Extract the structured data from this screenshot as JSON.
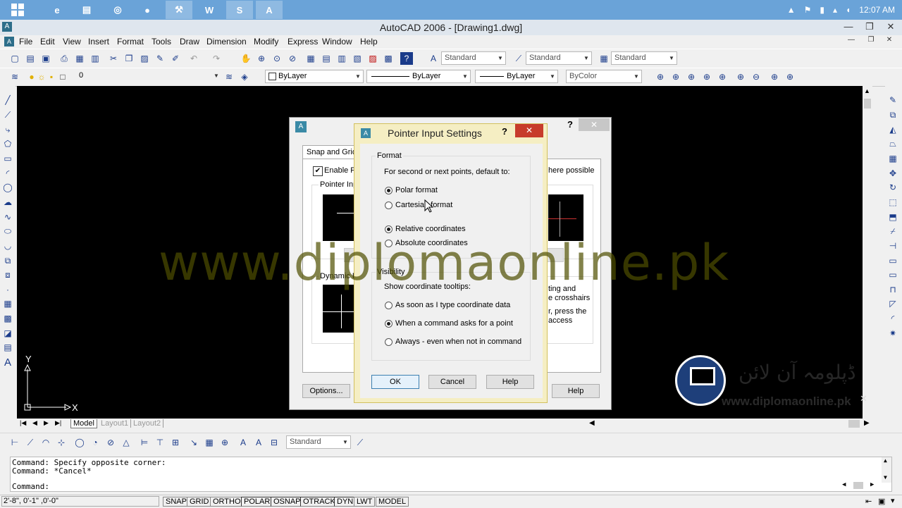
{
  "taskbar": {
    "apps": [
      "start-icon",
      "ie-icon",
      "explorer-icon",
      "chrome-icon",
      "firefox-icon",
      "tool-icon",
      "word-icon",
      "skype-icon",
      "autocad-icon"
    ],
    "clock": "12:07 AM"
  },
  "window": {
    "title": "AutoCAD 2006 - [Drawing1.dwg]"
  },
  "menu": [
    "File",
    "Edit",
    "View",
    "Insert",
    "Format",
    "Tools",
    "Draw",
    "Dimension",
    "Modify",
    "Express",
    "Window",
    "Help"
  ],
  "styles": {
    "text_style": "Standard",
    "dim_style": "Standard",
    "table_style": "Standard",
    "multileader_style": "Standard"
  },
  "layers": {
    "current": "0"
  },
  "properties": {
    "color": "ByLayer",
    "linetype": "ByLayer",
    "lineweight": "ByLayer",
    "plotstyle": "ByColor"
  },
  "watermark": "www.diplomaonline.pk",
  "back_dialog": {
    "tab": "Snap and Grid",
    "enable_label": "Enable Po",
    "where_possible": "here possible",
    "pointer_input_group": "Pointer Inpu",
    "dynamic_group": "Dynamic Pr",
    "right_text_1": "ting and",
    "right_text_2": "e crosshairs",
    "right_text_3": "r, press the",
    "right_text_4": "access",
    "options_button": "Options...",
    "help_button": "Help"
  },
  "dialog": {
    "title": "Pointer Input Settings",
    "help_glyph": "?",
    "close_glyph": "✕",
    "format_group": "Format",
    "format_desc": "For second or next points, default to:",
    "polar": "Polar format",
    "cartesian": "Cartesian format",
    "relative": "Relative coordinates",
    "absolute": "Absolute coordinates",
    "visibility_group": "Visibility",
    "visibility_desc": "Show coordinate tooltips:",
    "opt_type": "As soon as I type coordinate data",
    "opt_command": "When a command asks for a point",
    "opt_always": "Always - even when not in command",
    "ok": "OK",
    "cancel": "Cancel",
    "help": "Help"
  },
  "tabs": [
    "Model",
    "Layout1",
    "Layout2"
  ],
  "ucs": {
    "y": "Y",
    "x": "X"
  },
  "logo_text": "ڈپلومہ آن لائن",
  "logo_url": "www.diplomaonline.pk",
  "dim_toolbar": {
    "style": "Standard"
  },
  "command": {
    "line1": "Command: Specify opposite corner:",
    "line2": "Command: *Cancel*",
    "prompt": "Command:"
  },
  "status": {
    "coords": "2'-8\",  0'-1\" ,0'-0\"",
    "buttons": [
      "SNAP",
      "GRID",
      "ORTHO",
      "POLAR",
      "OSNAP",
      "OTRACK",
      "DYN",
      "LWT",
      "MODEL"
    ]
  }
}
